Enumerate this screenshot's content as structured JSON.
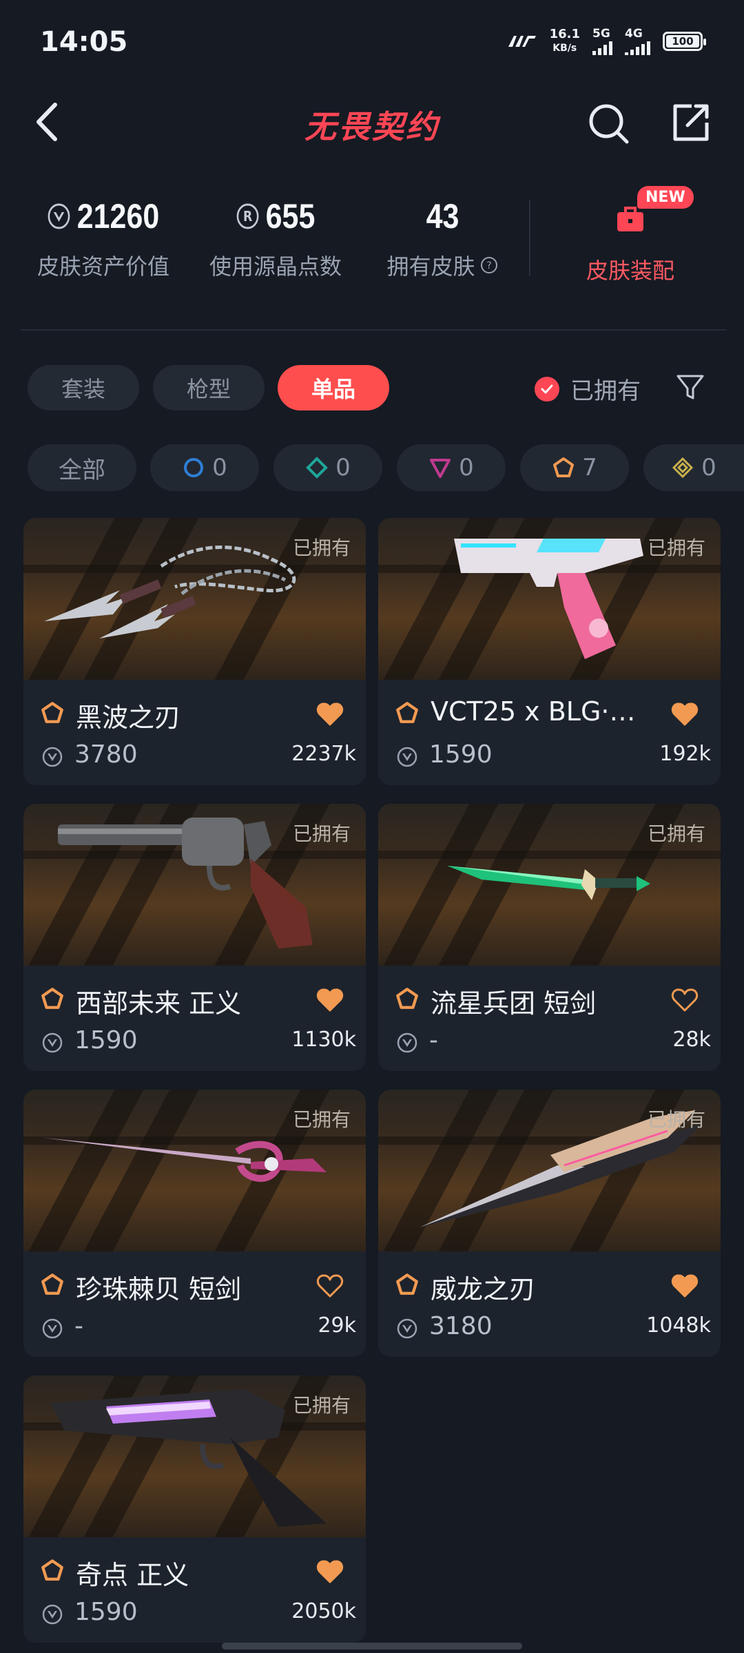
{
  "status": {
    "time": "14:05",
    "speed_value": "16.1",
    "speed_unit": "KB/s",
    "net1": "5G",
    "net2": "4G",
    "battery": "100",
    "battery_level": 1.0
  },
  "header": {
    "title": "无畏契约"
  },
  "stats": {
    "asset_value": "21260",
    "asset_label": "皮肤资产价值",
    "points": "655",
    "points_label": "使用源晶点数",
    "owned_count": "43",
    "owned_label": "拥有皮肤",
    "outfit_label": "皮肤装配",
    "new_badge": "NEW"
  },
  "tabs": {
    "items": [
      "套装",
      "枪型",
      "单品"
    ],
    "active": "单品"
  },
  "owned_filter": {
    "label": "已拥有",
    "checked": true
  },
  "tiers": [
    {
      "label": "全部"
    },
    {
      "count": "0",
      "color": "#2f7fd6"
    },
    {
      "count": "0",
      "color": "#1ea79a"
    },
    {
      "count": "0",
      "color": "#c03a8f"
    },
    {
      "count": "7",
      "color": "#f29a52"
    },
    {
      "count": "0",
      "color": "#c9b04a"
    }
  ],
  "cards": [
    {
      "name": "黑波之刃",
      "price": "3780",
      "likes": "2237k",
      "owned": "已拥有",
      "liked": true,
      "icon": "kunai-weapon-icon"
    },
    {
      "name": "VCT25 x BLG·…",
      "price": "1590",
      "likes": "192k",
      "owned": "已拥有",
      "liked": true,
      "icon": "pistol-weapon-icon"
    },
    {
      "name": "西部未来 正义",
      "price": "1590",
      "likes": "1130k",
      "owned": "已拥有",
      "liked": true,
      "icon": "revolver-weapon-icon"
    },
    {
      "name": "流星兵团 短剑",
      "price": "-",
      "likes": "28k",
      "owned": "已拥有",
      "liked": false,
      "icon": "dagger-weapon-icon"
    },
    {
      "name": "珍珠棘贝 短剑",
      "price": "-",
      "likes": "29k",
      "owned": "已拥有",
      "liked": false,
      "icon": "rapier-weapon-icon"
    },
    {
      "name": "威龙之刃",
      "price": "3180",
      "likes": "1048k",
      "owned": "已拥有",
      "liked": true,
      "icon": "blade-weapon-icon"
    },
    {
      "name": "奇点 正义",
      "price": "1590",
      "likes": "2050k",
      "owned": "已拥有",
      "liked": true,
      "icon": "revolver-weapon-icon"
    }
  ],
  "colors": {
    "accent": "#ff4655",
    "tier_orange": "#f29a52",
    "background": "#151a23"
  }
}
